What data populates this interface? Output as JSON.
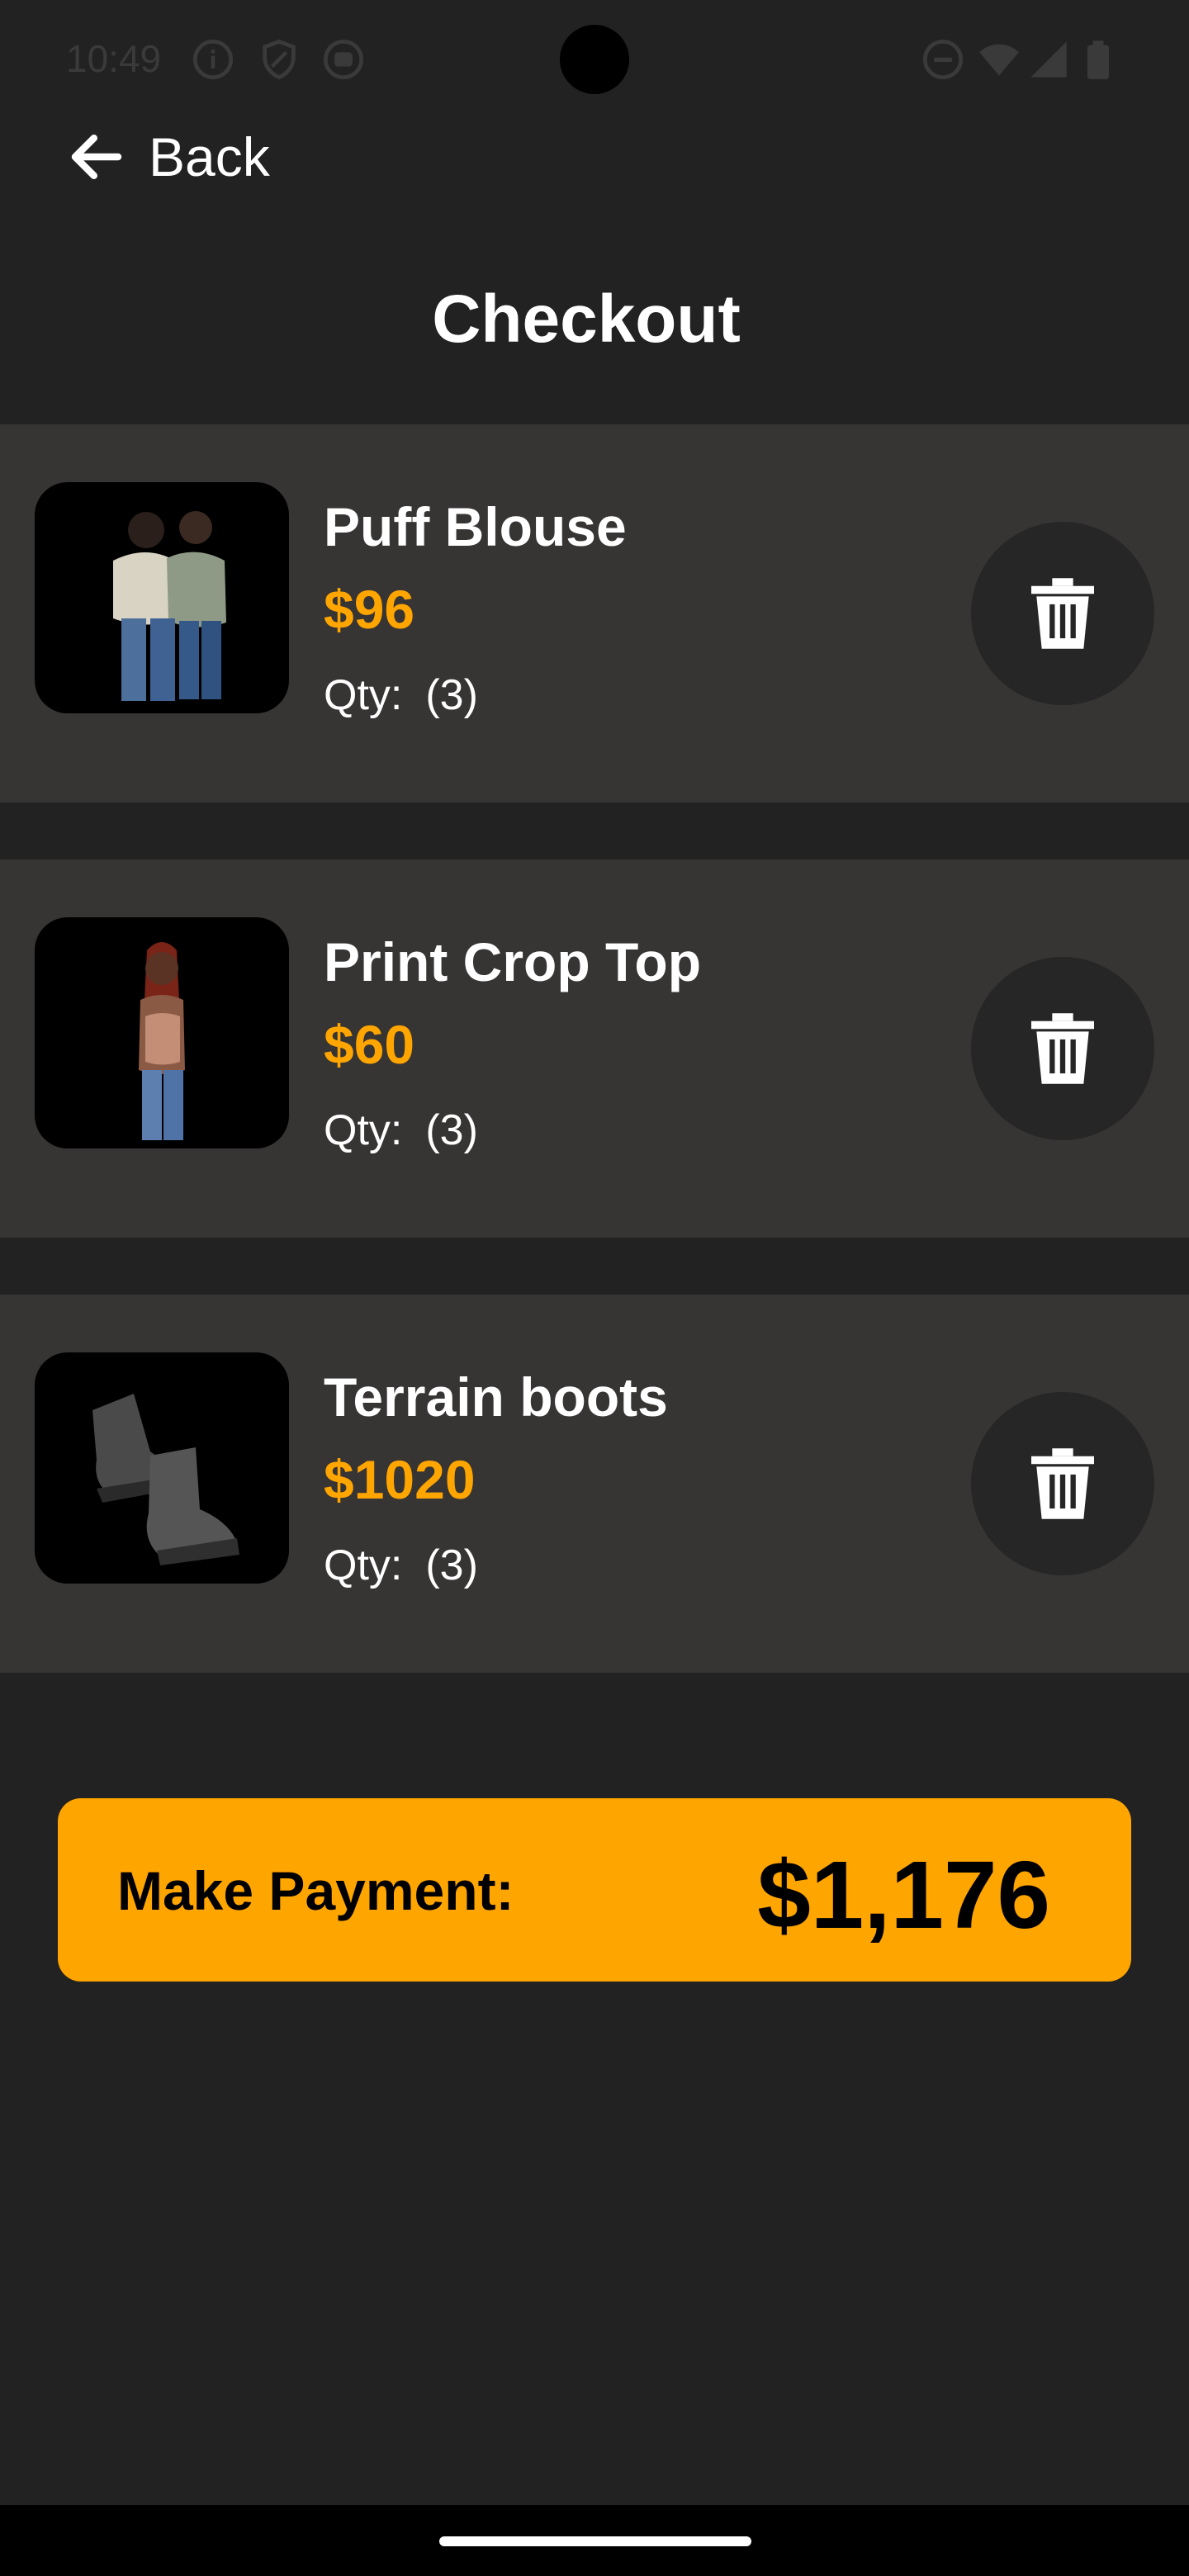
{
  "status_bar": {
    "time": "10:49",
    "left_icons": [
      "info-icon",
      "shield-icon",
      "app-icon"
    ],
    "right_icons": [
      "do-not-disturb-icon",
      "wifi-icon",
      "signal-icon",
      "battery-icon"
    ]
  },
  "header": {
    "back_label": "Back",
    "title": "Checkout"
  },
  "cart": {
    "qty_label": "Qty:",
    "items": [
      {
        "name": "Puff Blouse",
        "price": "$96",
        "qty": "(3)"
      },
      {
        "name": "Print Crop Top",
        "price": "$60",
        "qty": "(3)"
      },
      {
        "name": "Terrain boots",
        "price": "$1020",
        "qty": "(3)"
      }
    ]
  },
  "payment": {
    "label": "Make Payment:",
    "amount": "$1,176"
  },
  "colors": {
    "background": "#222222",
    "card": "#373434",
    "accent": "#ffa500",
    "delete_button": "#262626"
  }
}
